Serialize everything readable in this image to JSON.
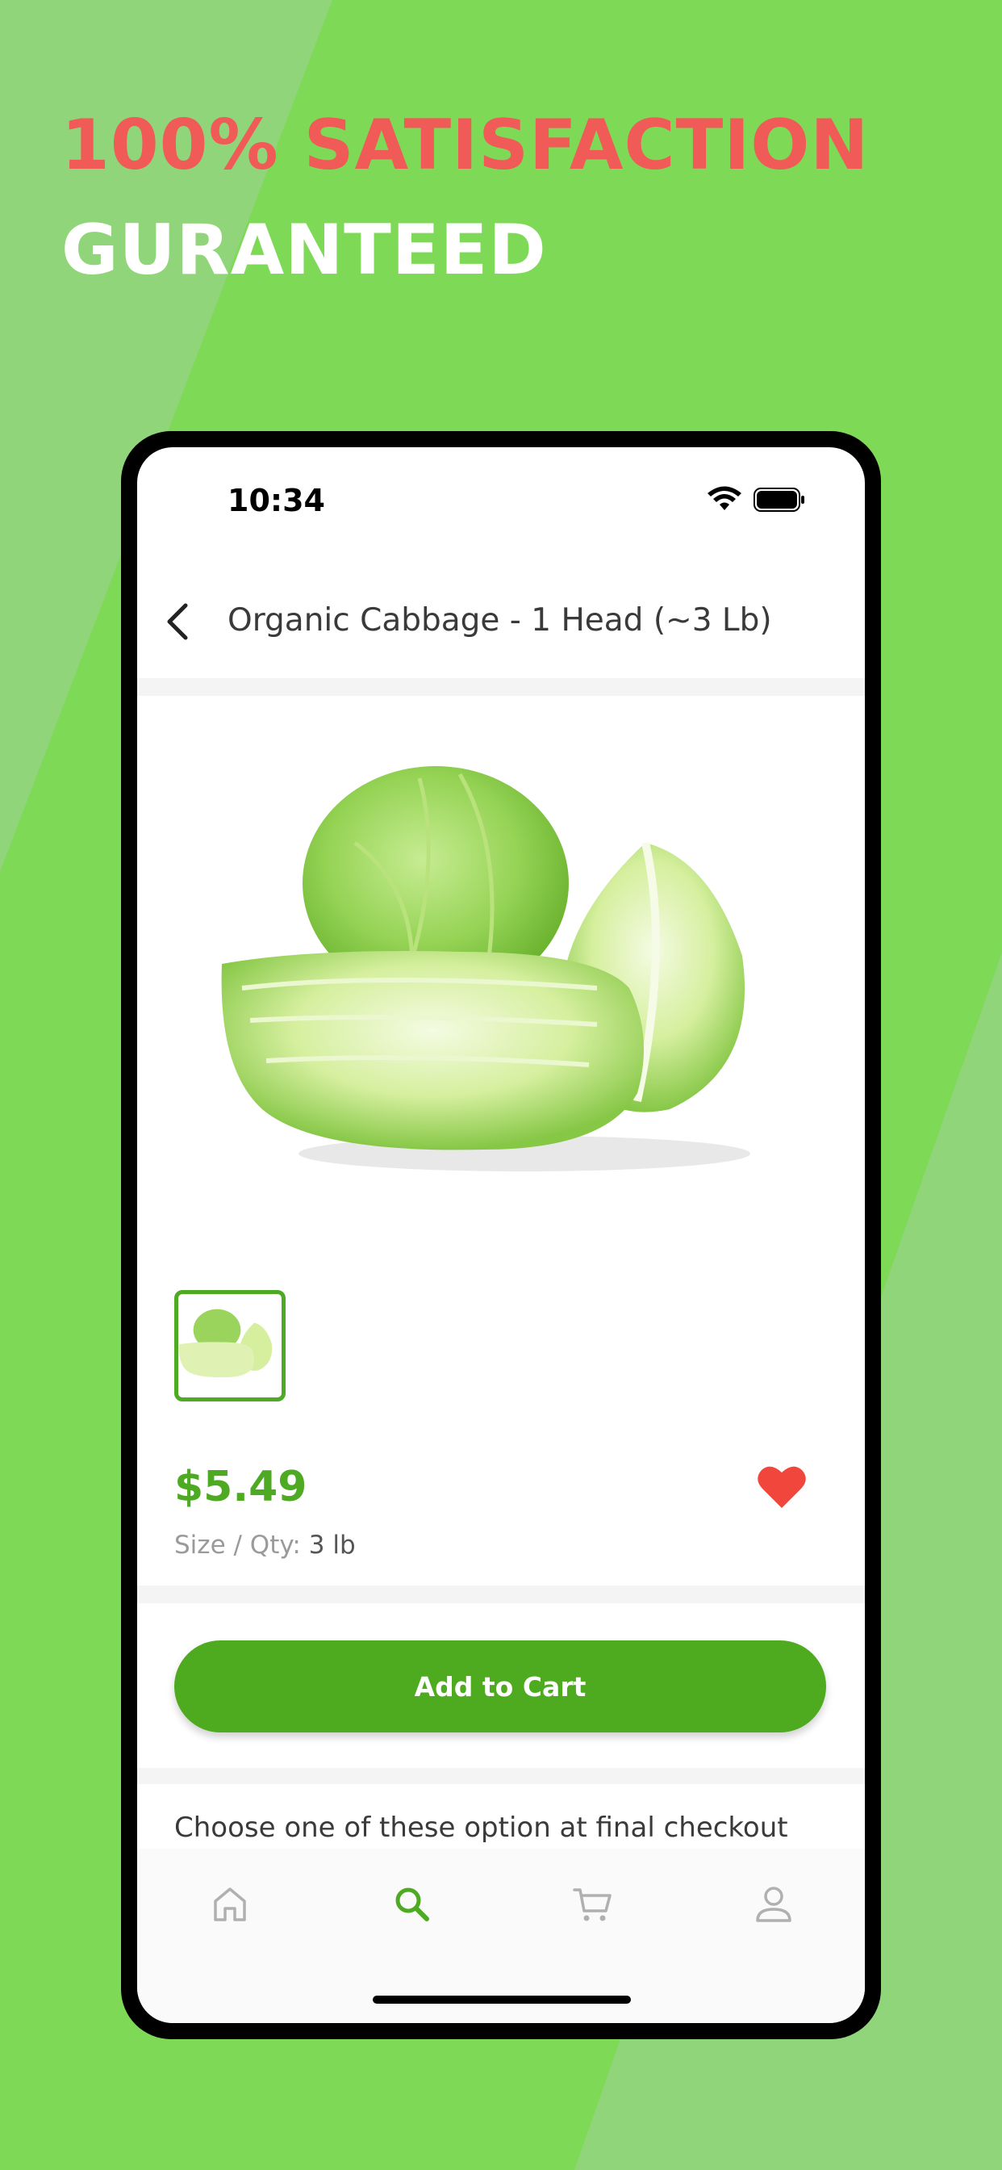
{
  "promo": {
    "line1": "100% SATISFACTION",
    "line2": "GURANTEED"
  },
  "status_bar": {
    "time": "10:34"
  },
  "header": {
    "title": "Organic Cabbage - 1 Head (~3 Lb)",
    "back_icon": "chevron-left-icon"
  },
  "product": {
    "price": "$5.49",
    "size_label": "Size / Qty:",
    "size_value": "3 lb",
    "favorite": true,
    "favorite_icon": "heart-icon"
  },
  "actions": {
    "add_to_cart_label": "Add to Cart"
  },
  "checkout": {
    "note": "Choose one of these option at final checkout"
  },
  "tab_bar": {
    "items": [
      {
        "icon": "home-icon",
        "active": false
      },
      {
        "icon": "search-icon",
        "active": true
      },
      {
        "icon": "cart-icon",
        "active": false
      },
      {
        "icon": "profile-icon",
        "active": false
      }
    ]
  },
  "colors": {
    "background": "#7ed957",
    "accent_green": "#4eaa22",
    "headline_red": "#f05a57",
    "heart_red": "#f0463c"
  }
}
